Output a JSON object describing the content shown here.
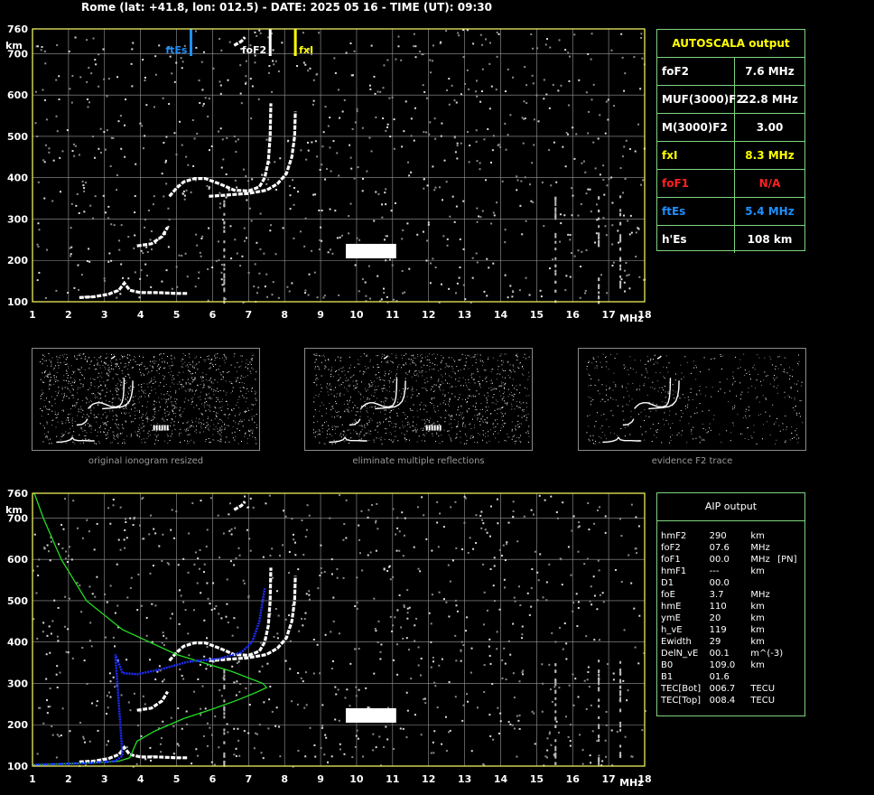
{
  "header": {
    "text": "Rome (lat: +41.8, lon: 012.5) - DATE: 2025 05 16 - TIME (UT): 09:30"
  },
  "colors": {
    "frame": "#ffff66",
    "grid": "#9a9a9a",
    "trace": "#ffffff",
    "ftEs": "#1e90ff",
    "fxI": "#ffff00",
    "foF1": "#ff2020",
    "profile": "#22dd22",
    "model_trace": "#1e2eff",
    "panel_border": "#7fd37f"
  },
  "chart_data": [
    {
      "type": "scatter",
      "name": "ionogram",
      "xlabel": "MHz",
      "ylabel": "km",
      "xlim": [
        1,
        18
      ],
      "ylim": [
        100,
        760
      ],
      "x_ticks": [
        "1",
        "2",
        "3",
        "4",
        "5",
        "6",
        "7",
        "8",
        "9",
        "10",
        "11",
        "12",
        "13",
        "14",
        "15",
        "16",
        "17",
        "18"
      ],
      "y_ticks": [
        "100",
        "200",
        "300",
        "400",
        "500",
        "600",
        "700",
        "760"
      ],
      "markers": [
        {
          "label": "ftEs",
          "freq": 5.4
        },
        {
          "label": "foF2",
          "freq": 7.6
        },
        {
          "label": "fxI",
          "freq": 8.3
        }
      ],
      "traces": [
        {
          "series": "E",
          "points": [
            [
              2.3,
              110
            ],
            [
              2.7,
              112
            ],
            [
              3.1,
              118
            ],
            [
              3.4,
              128
            ],
            [
              3.55,
              145
            ],
            [
              3.7,
              128
            ],
            [
              4.0,
              122
            ],
            [
              4.5,
              122
            ],
            [
              5.0,
              120
            ],
            [
              5.3,
              120
            ]
          ]
        },
        {
          "series": "F1",
          "points": [
            [
              3.9,
              235
            ],
            [
              4.3,
              240
            ],
            [
              4.6,
              258
            ],
            [
              4.75,
              280
            ]
          ]
        },
        {
          "series": "F2o",
          "points": [
            [
              4.8,
              355
            ],
            [
              5.0,
              375
            ],
            [
              5.2,
              390
            ],
            [
              5.5,
              398
            ],
            [
              5.8,
              398
            ],
            [
              6.2,
              385
            ],
            [
              6.6,
              370
            ],
            [
              7.0,
              368
            ],
            [
              7.3,
              378
            ],
            [
              7.45,
              400
            ],
            [
              7.55,
              440
            ],
            [
              7.6,
              500
            ],
            [
              7.62,
              580
            ]
          ]
        },
        {
          "series": "F2x",
          "points": [
            [
              5.9,
              355
            ],
            [
              6.4,
              358
            ],
            [
              7.0,
              362
            ],
            [
              7.5,
              370
            ],
            [
              7.8,
              385
            ],
            [
              8.05,
              410
            ],
            [
              8.2,
              450
            ],
            [
              8.28,
              500
            ],
            [
              8.3,
              560
            ]
          ]
        },
        {
          "series": "blob",
          "points": [
            [
              6.6,
              720
            ],
            [
              6.8,
              730
            ],
            [
              6.9,
              740
            ]
          ]
        }
      ]
    },
    {
      "type": "line",
      "name": "aip-profile",
      "xlabel": "MHz",
      "ylabel": "km",
      "xlim": [
        1,
        18
      ],
      "ylim": [
        100,
        760
      ],
      "x_ticks": [
        "1",
        "2",
        "3",
        "4",
        "5",
        "6",
        "7",
        "8",
        "9",
        "10",
        "11",
        "12",
        "13",
        "14",
        "15",
        "16",
        "17",
        "18"
      ],
      "y_ticks": [
        "100",
        "200",
        "300",
        "400",
        "500",
        "600",
        "700",
        "760"
      ],
      "profile": [
        [
          1.0,
          103
        ],
        [
          2.0,
          106
        ],
        [
          3.0,
          109
        ],
        [
          3.4,
          112
        ],
        [
          3.7,
          120
        ],
        [
          3.9,
          160
        ],
        [
          4.4,
          185
        ],
        [
          5.2,
          215
        ],
        [
          6.0,
          238
        ],
        [
          6.7,
          260
        ],
        [
          7.2,
          278
        ],
        [
          7.5,
          290
        ],
        [
          7.4,
          300
        ],
        [
          6.5,
          330
        ],
        [
          5.0,
          370
        ],
        [
          3.5,
          430
        ],
        [
          2.5,
          500
        ],
        [
          1.8,
          600
        ],
        [
          1.3,
          700
        ],
        [
          1.05,
          760
        ]
      ],
      "model_trace": [
        [
          1.0,
          103
        ],
        [
          2.5,
          107
        ],
        [
          3.3,
          112
        ],
        [
          3.5,
          125
        ],
        [
          3.3,
          370
        ],
        [
          3.5,
          325
        ],
        [
          3.9,
          322
        ],
        [
          4.6,
          335
        ],
        [
          5.3,
          352
        ],
        [
          6.2,
          360
        ],
        [
          6.8,
          375
        ],
        [
          7.1,
          400
        ],
        [
          7.3,
          450
        ],
        [
          7.45,
          530
        ]
      ]
    }
  ],
  "autoscala": {
    "title": "AUTOSCALA output",
    "rows": [
      {
        "label": "foF2",
        "value": "7.6 MHz",
        "color": "#ffffff"
      },
      {
        "label": "MUF(3000)F2",
        "value": "22.8 MHz",
        "color": "#ffffff"
      },
      {
        "label": "M(3000)F2",
        "value": "3.00",
        "color": "#ffffff"
      },
      {
        "label": "fxI",
        "value": "8.3 MHz",
        "color": "#ffff00"
      },
      {
        "label": "foF1",
        "value": "N/A",
        "color": "#ff2020"
      },
      {
        "label": "ftEs",
        "value": "5.4 MHz",
        "color": "#1e90ff"
      },
      {
        "label": "h'Es",
        "value": "108     km",
        "color": "#ffffff"
      }
    ]
  },
  "aip": {
    "title": "AIP output",
    "rows": [
      {
        "name": "hmF2",
        "value": "290",
        "unit": "km",
        "extra": ""
      },
      {
        "name": "foF2",
        "value": "07.6",
        "unit": "MHz",
        "extra": ""
      },
      {
        "name": "foF1",
        "value": "00.0",
        "unit": "MHz",
        "extra": "[PN]"
      },
      {
        "name": "hmF1",
        "value": "---",
        "unit": "km",
        "extra": ""
      },
      {
        "name": "D1",
        "value": "00.0",
        "unit": "",
        "extra": ""
      },
      {
        "name": "foE",
        "value": "3.7",
        "unit": "MHz",
        "extra": ""
      },
      {
        "name": "hmE",
        "value": "110",
        "unit": "km",
        "extra": ""
      },
      {
        "name": "ymE",
        "value": "20",
        "unit": "km",
        "extra": ""
      },
      {
        "name": "h_vE",
        "value": "119",
        "unit": "km",
        "extra": ""
      },
      {
        "name": "Ewidth",
        "value": "29",
        "unit": "km",
        "extra": ""
      },
      {
        "name": "DelN_vE",
        "value": "00.1",
        "unit": "m^(-3)",
        "extra": ""
      },
      {
        "name": "B0",
        "value": "109.0",
        "unit": "km",
        "extra": ""
      },
      {
        "name": "B1",
        "value": "01.6",
        "unit": "",
        "extra": ""
      },
      {
        "name": "TEC[Bot]",
        "value": "006.7",
        "unit": "TECU",
        "extra": ""
      },
      {
        "name": "TEC[Top]",
        "value": "008.4",
        "unit": "TECU",
        "extra": ""
      }
    ]
  },
  "thumbnails": [
    {
      "caption": "original ionogram resized"
    },
    {
      "caption": "eliminate multiple reflections"
    },
    {
      "caption": "evidence F2 trace"
    }
  ]
}
